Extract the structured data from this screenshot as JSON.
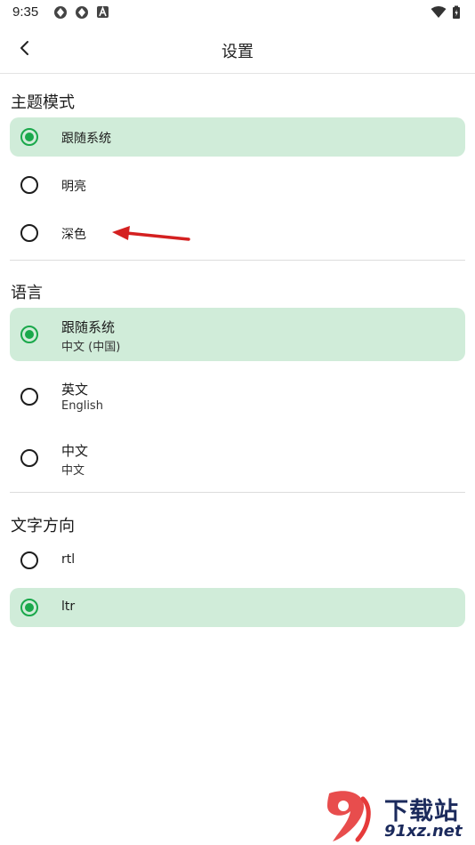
{
  "status_bar": {
    "time": "9:35"
  },
  "app_bar": {
    "title": "设置"
  },
  "sections": {
    "theme": {
      "title": "主题模式",
      "options": [
        {
          "label": "跟随系统",
          "selected": true
        },
        {
          "label": "明亮",
          "selected": false
        },
        {
          "label": "深色",
          "selected": false
        }
      ]
    },
    "language": {
      "title": "语言",
      "options": [
        {
          "label": "跟随系统",
          "sub": "中文 (中国)",
          "selected": true
        },
        {
          "label": "英文",
          "sub": "English",
          "selected": false
        },
        {
          "label": "中文",
          "sub": "中文",
          "selected": false
        }
      ]
    },
    "direction": {
      "title": "文字方向",
      "options": [
        {
          "label": "rtl",
          "selected": false
        },
        {
          "label": "ltr",
          "selected": true
        }
      ]
    }
  },
  "watermark": {
    "line1": "下载站",
    "line2": "91xz.net"
  },
  "colors": {
    "accent": "#1aa84b",
    "selected_bg": "#d0ecd9",
    "annotation": "#d42020"
  }
}
